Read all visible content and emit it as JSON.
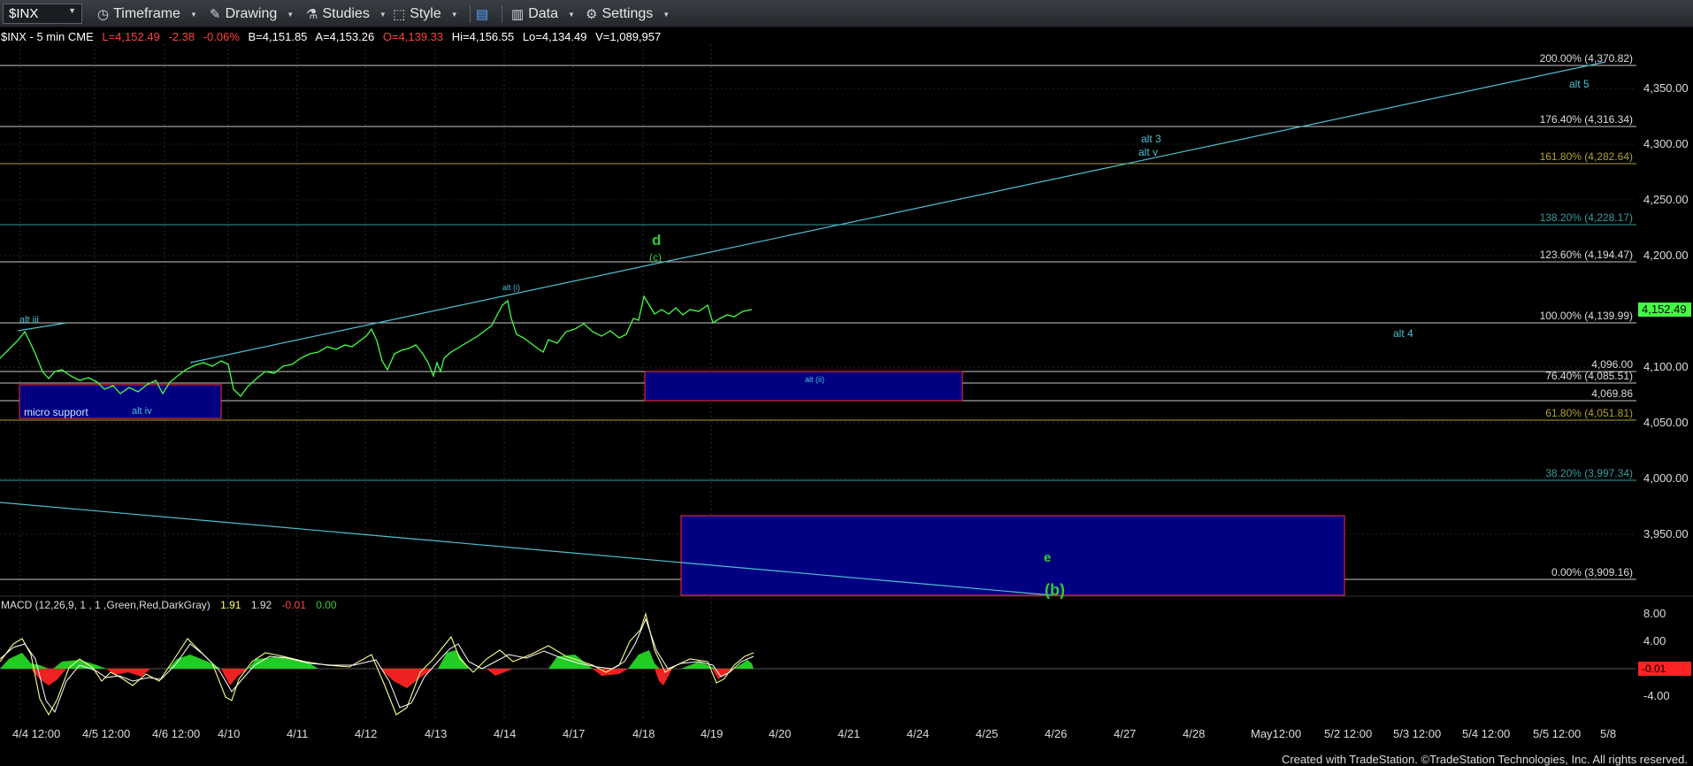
{
  "toolbar": {
    "symbol": "$INX",
    "timeframe": "Timeframe",
    "drawing": "Drawing",
    "studies": "Studies",
    "style": "Style",
    "data": "Data",
    "settings": "Settings"
  },
  "info": {
    "symbol": "$INX - 5 min  CME",
    "last": "L=4,152.49",
    "change": "-2.38",
    "change_pct": "-0.06%",
    "bid": "B=4,151.85",
    "ask": "A=4,153.26",
    "ask_open": "O=4,139.33",
    "high": "Hi=4,156.55",
    "low": "Lo=4,134.49",
    "volume": "V=1,089,957"
  },
  "price_axis": [
    "4,350.00",
    "4,300.00",
    "4,250.00",
    "4,200.00",
    "4,100.00",
    "4,050.00",
    "4,000.00",
    "3,950.00"
  ],
  "last_price": "4,152.49",
  "fib_labels": [
    {
      "text": "200.00% (4,370.82)",
      "color": "#c8c8c8"
    },
    {
      "text": "176.40% (4,316.34)",
      "color": "#c8c8c8"
    },
    {
      "text": "161.80% (4,282.64)",
      "color": "#b0a030"
    },
    {
      "text": "138.20% (4,228.17)",
      "color": "#3a9a9a"
    },
    {
      "text": "123.60% (4,194.47)",
      "color": "#c8c8c8"
    },
    {
      "text": "100.00% (4,139.99)",
      "color": "#c8c8c8"
    },
    {
      "text": "4,096.00",
      "color": "#c8c8c8"
    },
    {
      "text": "76.40% (4,085.51)",
      "color": "#c8c8c8"
    },
    {
      "text": "4,069.86",
      "color": "#c8c8c8"
    },
    {
      "text": "61.80% (4,051.81)",
      "color": "#b0a030"
    },
    {
      "text": "38.20% (3,997.34)",
      "color": "#3a9a9a"
    },
    {
      "text": "0.00% (3,909.16)",
      "color": "#c8c8c8"
    }
  ],
  "wave_labels": {
    "alt_iii": "alt iii",
    "micro_support": "micro support",
    "alt_iv": "alt iv",
    "alt_i": "alt (i)",
    "d": "d",
    "c": "(c)",
    "alt_ii": "alt (ii)",
    "alt_3": "alt 3",
    "alt_v": "alt v",
    "alt_5": "alt 5",
    "alt_4": "alt 4",
    "e": "e",
    "b": "(b)"
  },
  "macd": {
    "label": "MACD (12,26,9, 1 , 1 ,Green,Red,DarkGray)",
    "v1": "1.91",
    "v2": "1.92",
    "v3": "-0.01",
    "v4": "0.00",
    "axis": [
      "8.00",
      "4.00",
      "-4.00"
    ],
    "last": "-0.01"
  },
  "x_axis": [
    "4/4 12:00",
    "4/5 12:00",
    "4/6 12:00",
    "4/10",
    "4/11",
    "4/12",
    "4/13",
    "4/14",
    "4/17",
    "4/18",
    "4/19",
    "4/20",
    "4/21",
    "4/24",
    "4/25",
    "4/26",
    "4/27",
    "4/28",
    "May12:00",
    "5/2 12:00",
    "5/3 12:00",
    "5/4 12:00",
    "5/5 12:00",
    "5/8"
  ],
  "footer": "Created with TradeStation. ©TradeStation Technologies, Inc. All rights reserved.",
  "colors": {
    "price": "#44ff44",
    "channel": "#4fc0d0",
    "box_fill": "#000080",
    "box_border": "#ff3030",
    "macd_fast": "#ffff88",
    "macd_slow": "#ffffff",
    "hist_pos": "#22cc22",
    "hist_neg": "#ee2222"
  }
}
